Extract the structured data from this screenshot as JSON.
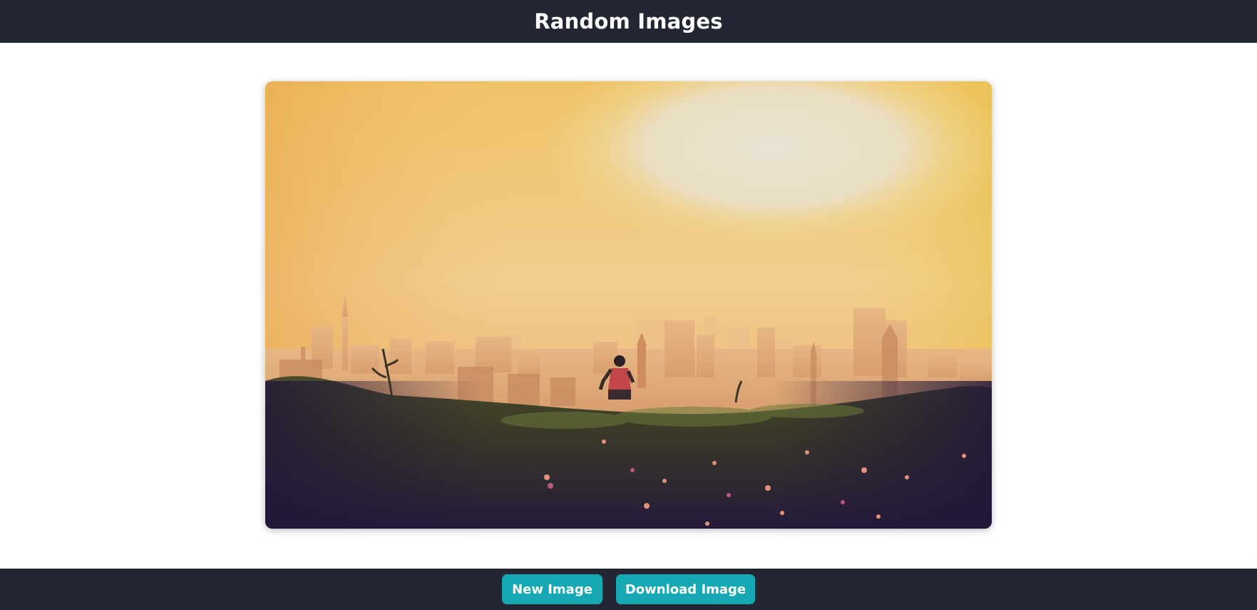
{
  "header": {
    "title": "Random Images"
  },
  "main": {
    "photo": {
      "subject": "silhouette of a city skyline at sunset with a person running through a flowering garden"
    }
  },
  "footer": {
    "new_image_label": "New Image",
    "download_image_label": "Download Image"
  },
  "colors": {
    "bar_background": "#222733",
    "button_accent": "#16a9b3",
    "button_text": "#ffffff",
    "page_background": "#ffffff"
  }
}
